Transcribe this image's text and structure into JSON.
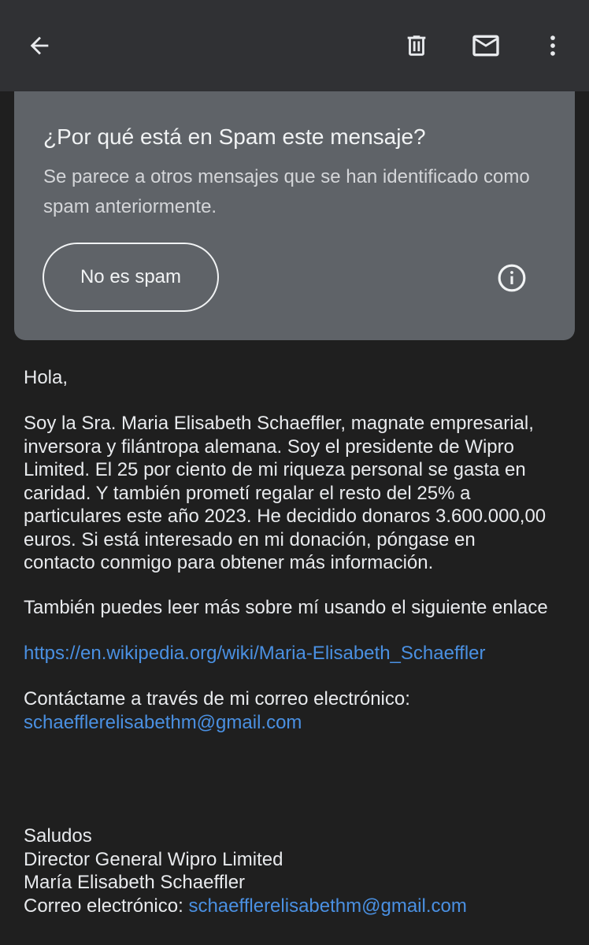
{
  "toolbar": {
    "back_icon": "arrow-left-icon",
    "delete_icon": "trash-icon",
    "mark_unread_icon": "mail-icon",
    "more_icon": "more-vert-icon"
  },
  "spam_banner": {
    "title": "¿Por qué está en Spam este mensaje?",
    "description": "Se parece a otros mensajes que se han identificado como spam anteriormente.",
    "not_spam_button": "No es spam",
    "info_icon": "info-icon"
  },
  "message": {
    "greeting": "Hola,",
    "paragraph_lines": [
      "Soy la Sra. Maria Elisabeth Schaeffler, magnate empresarial,",
      "inversora y filántropa alemana. Soy el presidente de Wipro",
      "Limited. El 25 por ciento de mi riqueza personal se gasta en",
      "caridad. Y también prometí regalar el resto del 25% a",
      "particulares este año 2023. He decidido donaros 3.600.000,00",
      "euros. Si está interesado en mi donación, póngase en",
      "contacto conmigo para obtener más información."
    ],
    "read_more": "También puedes leer más sobre mí usando el siguiente enlace",
    "wiki_link": "https://en.wikipedia.org/wiki/Maria-Elisabeth_Schaeffler",
    "contact_prompt": "Contáctame a través de mi correo electrónico:",
    "contact_email": "schaefflerelisabethm@gmail.com",
    "signature": {
      "closing": "Saludos",
      "role": "Director General Wipro Limited",
      "name": "María Elisabeth Schaeffler",
      "email_label": "Correo electrónico:",
      "email": "schaefflerelisabethm@gmail.com"
    }
  },
  "colors": {
    "background": "#1f1f1f",
    "app_bar": "#303134",
    "banner": "#5f6368",
    "link": "#4a90e2"
  }
}
